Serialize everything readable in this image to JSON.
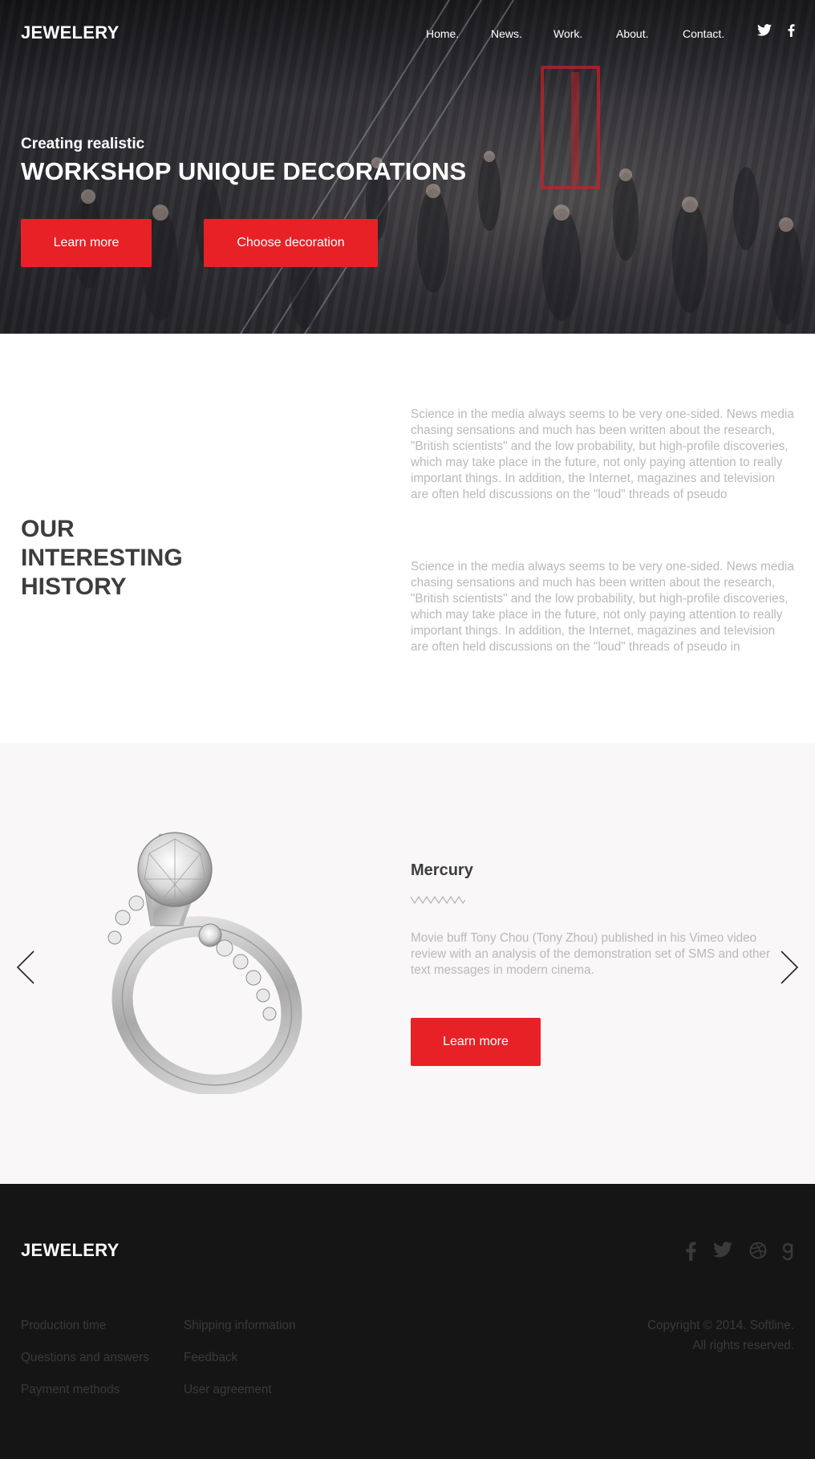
{
  "brand": {
    "logo": "JEWELERY"
  },
  "nav": {
    "items": [
      {
        "label": "Home."
      },
      {
        "label": "News."
      },
      {
        "label": "Work."
      },
      {
        "label": "About."
      },
      {
        "label": "Contact."
      }
    ],
    "social": [
      "twitter-icon",
      "facebook-icon"
    ]
  },
  "hero": {
    "tagline": "Creating realistic",
    "headline": "WORKSHOP UNIQUE DECORATIONS",
    "primary_button": "Learn more",
    "secondary_button": "Choose decoration"
  },
  "history": {
    "title_lines": [
      "OUR",
      "INTERESTING",
      "HISTORY"
    ],
    "paragraphs": [
      "Science in the media always seems to be very one-sided. News media chasing sensations and much has been written about the research, \"British scientists\" and the low probability, but high-profile discoveries, which may take place in the future, not only paying attention to really important things. In addition, the Internet, magazines and television are often held discussions on the \"loud\" threads of pseudo",
      "Science in the media always seems to be very one-sided. News media chasing sensations and much has been written about the research, \"British scientists\" and the low probability, but high-profile discoveries, which may take place in the future, not only paying attention to really important things. In addition, the Internet, magazines and television are often held discussions on the \"loud\" threads of pseudo in"
    ]
  },
  "slider": {
    "title": "Mercury",
    "description": "Movie buff Tony Chou (Tony Zhou) published in his Vimeo video review with an analysis of the demonstration set of SMS and other text messages in modern cinema.",
    "button": "Learn more",
    "prev_icon": "chevron-left-icon",
    "next_icon": "chevron-right-icon",
    "image": "diamond-ring"
  },
  "footer": {
    "logo": "JEWELERY",
    "social": [
      "facebook-icon",
      "twitter-icon",
      "dribbble-icon",
      "google-icon"
    ],
    "links_col1": [
      "Production time",
      "Questions and answers",
      "Payment methods"
    ],
    "links_col2": [
      "Shipping information",
      "Feedback",
      "User agreement"
    ],
    "copyright_line1": "Copyright © 2014. Softline.",
    "copyright_line2": "All rights reserved."
  },
  "colors": {
    "accent": "#e82127",
    "footer_bg": "#151515",
    "slider_bg": "#f9f7f7",
    "muted_text": "#b9b9b9",
    "heading_text": "#3d3d3d"
  }
}
